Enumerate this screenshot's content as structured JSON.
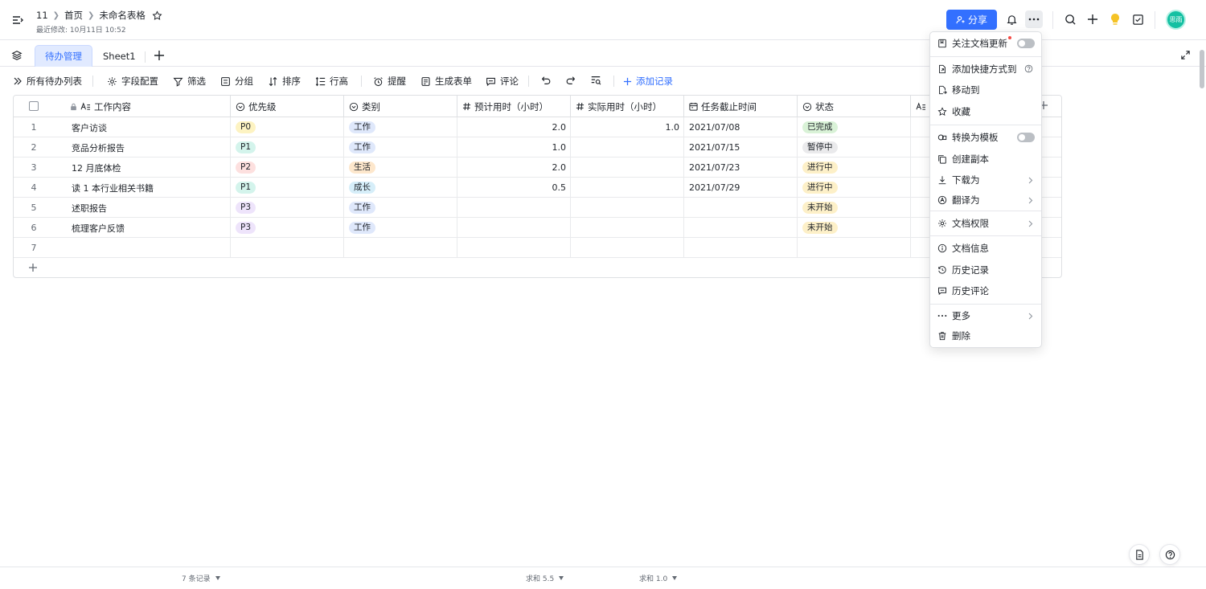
{
  "header": {
    "breadcrumbs": [
      "11",
      "首页"
    ],
    "doc_title": "未命名表格",
    "last_modified": "最近修改: 10月11日 10:52",
    "share_label": "分享",
    "avatar_text": "思雨"
  },
  "tabs": {
    "items": [
      "待办管理",
      "Sheet1"
    ],
    "active": "待办管理"
  },
  "toolbar": {
    "view": "所有待办列表",
    "fields": "字段配置",
    "filter": "筛选",
    "group": "分组",
    "sort": "排序",
    "row_height": "行高",
    "remind": "提醒",
    "form": "生成表单",
    "comment": "评论",
    "add_record": "添加记录"
  },
  "table": {
    "columns": [
      "工作内容",
      "优先级",
      "类别",
      "预计用时（小时）",
      "实际用时（小时）",
      "任务截止时间",
      "状态"
    ],
    "rows": [
      {
        "n": "1",
        "task": "客户访谈",
        "priority": "P0",
        "category": "工作",
        "est": "2.0",
        "act": "1.0",
        "due": "2021/07/08",
        "status": "已完成"
      },
      {
        "n": "2",
        "task": "竞品分析报告",
        "priority": "P1",
        "category": "工作",
        "est": "1.0",
        "act": "",
        "due": "2021/07/15",
        "status": "暂停中"
      },
      {
        "n": "3",
        "task": "12 月底体检",
        "priority": "P2",
        "category": "生活",
        "est": "2.0",
        "act": "",
        "due": "2021/07/23",
        "status": "进行中"
      },
      {
        "n": "4",
        "task": "读 1 本行业相关书籍",
        "priority": "P1",
        "category": "成长",
        "est": "0.5",
        "act": "",
        "due": "2021/07/29",
        "status": "进行中"
      },
      {
        "n": "5",
        "task": "述职报告",
        "priority": "P3",
        "category": "工作",
        "est": "",
        "act": "",
        "due": "",
        "status": "未开始"
      },
      {
        "n": "6",
        "task": "梳理客户反馈",
        "priority": "P3",
        "category": "工作",
        "est": "",
        "act": "",
        "due": "",
        "status": "未开始"
      },
      {
        "n": "7",
        "task": "",
        "priority": "",
        "category": "",
        "est": "",
        "act": "",
        "due": "",
        "status": ""
      }
    ],
    "tag_colors": {
      "P0": {
        "bg": "#fdf3c2",
        "fg": "#1f2329"
      },
      "P1": {
        "bg": "#d4f4ec",
        "fg": "#1f2329"
      },
      "P2": {
        "bg": "#fde0df",
        "fg": "#1f2329"
      },
      "P3": {
        "bg": "#eee4fb",
        "fg": "#1f2329"
      },
      "工作": {
        "bg": "#dfe8fb",
        "fg": "#1f2329"
      },
      "生活": {
        "bg": "#fde7cc",
        "fg": "#1f2329"
      },
      "成长": {
        "bg": "#d6eef9",
        "fg": "#1f2329"
      },
      "已完成": {
        "bg": "#d9f2d7",
        "fg": "#1f2329"
      },
      "暂停中": {
        "bg": "#eaeaec",
        "fg": "#1f2329"
      },
      "进行中": {
        "bg": "#fdf0c8",
        "fg": "#1f2329"
      },
      "未开始": {
        "bg": "#fdf0c8",
        "fg": "#1f2329"
      }
    }
  },
  "footer": {
    "records": "7 条记录",
    "sum_est": "求和 5.5",
    "sum_act": "求和 1.0"
  },
  "menu": {
    "follow": "关注文档更新",
    "shortcut": "添加快捷方式到",
    "move": "移动到",
    "favorite": "收藏",
    "template": "转换为模板",
    "copy": "创建副本",
    "download": "下载为",
    "translate": "翻译为",
    "permission": "文档权限",
    "info": "文档信息",
    "history": "历史记录",
    "history_comment": "历史评论",
    "more": "更多",
    "delete": "删除"
  },
  "colors": {
    "accent": "#3370ff",
    "avatar": "#14c0a2"
  }
}
